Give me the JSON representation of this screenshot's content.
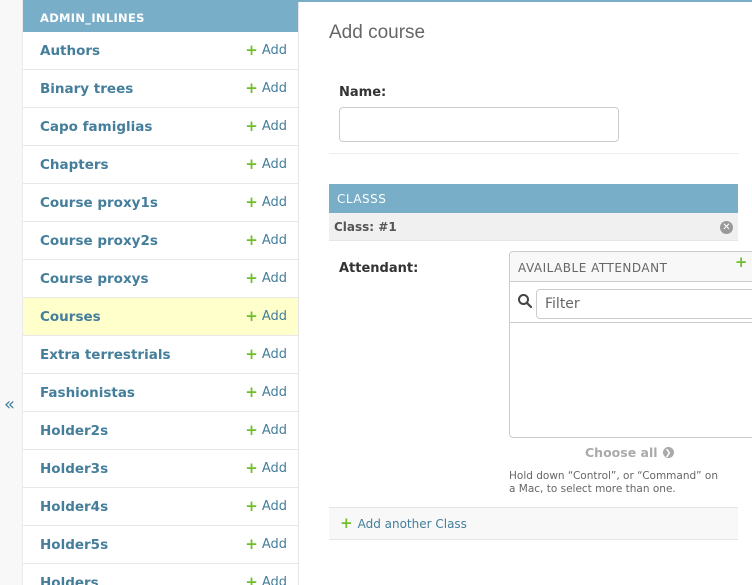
{
  "app": {
    "caption": "ADMIN_INLINES",
    "collapse_glyph": "«"
  },
  "sidebar": {
    "add_label": "Add",
    "items": [
      {
        "label": "Authors"
      },
      {
        "label": "Binary trees"
      },
      {
        "label": "Capo famiglias"
      },
      {
        "label": "Chapters"
      },
      {
        "label": "Course proxy1s"
      },
      {
        "label": "Course proxy2s"
      },
      {
        "label": "Course proxys"
      },
      {
        "label": "Courses",
        "current": true
      },
      {
        "label": "Extra terrestrials"
      },
      {
        "label": "Fashionistas"
      },
      {
        "label": "Holder2s"
      },
      {
        "label": "Holder3s"
      },
      {
        "label": "Holder4s"
      },
      {
        "label": "Holder5s"
      },
      {
        "label": "Holders"
      }
    ]
  },
  "main": {
    "title": "Add course",
    "name_label": "Name:",
    "name_value": "",
    "inline": {
      "header": "CLASSS",
      "item_label": "Class: #1",
      "attendant_label": "Attendant:",
      "selector_title": "AVAILABLE ATTENDANT",
      "filter_placeholder": "Filter",
      "choose_all": "Choose all",
      "help_text": "Hold down “Control”, or “Command” on a Mac, to select more than one.",
      "add_another": "Add another Class"
    }
  },
  "colors": {
    "accent": "#79aec8",
    "link": "#447e9b",
    "add_green": "#70bf2b",
    "current_row": "#ffffcc"
  }
}
